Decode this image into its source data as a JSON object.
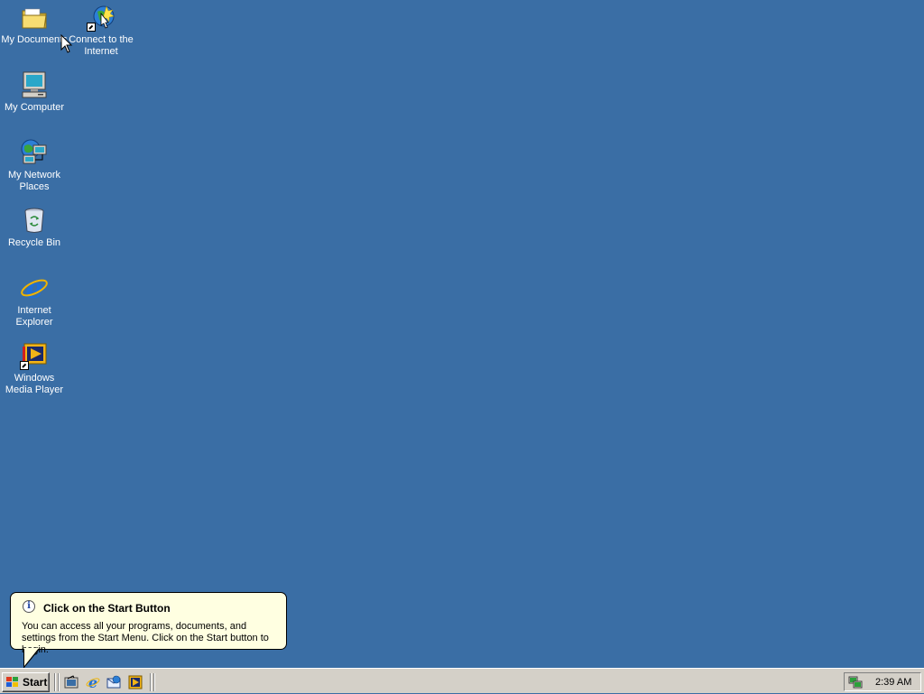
{
  "desktop": {
    "background_color": "#3a6ea5",
    "icons": [
      {
        "name": "my-documents",
        "label": "My Documents",
        "icon": "folder-icon"
      },
      {
        "name": "connect-internet",
        "label": "Connect to the Internet",
        "icon": "connect-wizard-icon"
      },
      {
        "name": "my-computer",
        "label": "My Computer",
        "icon": "computer-icon"
      },
      {
        "name": "my-network-places",
        "label": "My Network Places",
        "icon": "network-icon"
      },
      {
        "name": "recycle-bin",
        "label": "Recycle Bin",
        "icon": "recycle-bin-icon"
      },
      {
        "name": "internet-explorer",
        "label": "Internet Explorer",
        "icon": "ie-icon"
      },
      {
        "name": "windows-media-player",
        "label": "Windows Media Player",
        "icon": "media-player-icon"
      }
    ]
  },
  "balloon": {
    "title": "Click on the Start Button",
    "text": "You can access all your programs, documents, and settings from the Start Menu. Click on the Start button to begin.",
    "icon": "info-icon"
  },
  "taskbar": {
    "start_label": "Start",
    "quick_launch": [
      "show-desktop-icon",
      "ie-icon",
      "outlook-express-icon",
      "media-player-icon"
    ],
    "clock": "2:39 AM",
    "tray_icons": [
      "network-status-icon"
    ]
  }
}
